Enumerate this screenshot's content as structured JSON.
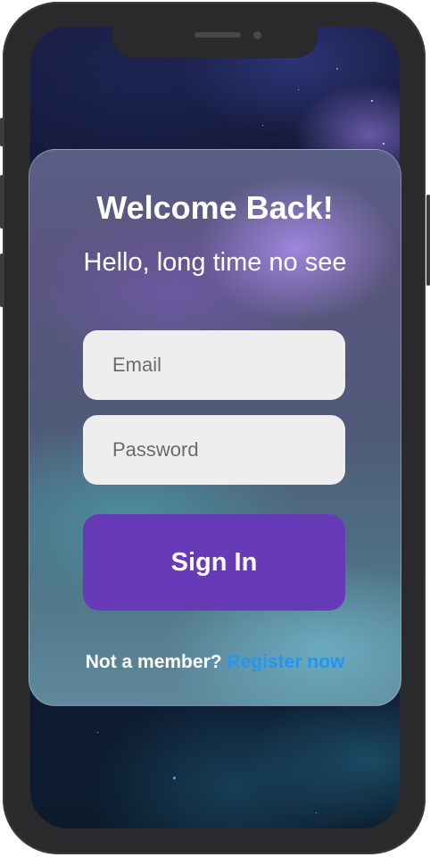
{
  "login": {
    "title": "Welcome Back!",
    "subtitle": "Hello, long time no see",
    "email_placeholder": "Email",
    "password_placeholder": "Password",
    "signin_label": "Sign In",
    "not_member_text": "Not a member?",
    "register_link_text": "Register now"
  },
  "colors": {
    "primary_button": "#673ab7",
    "link": "#2196f3",
    "input_background": "#eeeeee",
    "text": "#ffffff"
  }
}
